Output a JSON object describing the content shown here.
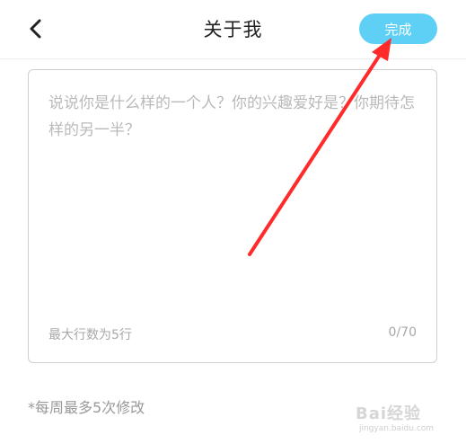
{
  "header": {
    "title": "关于我",
    "done_label": "完成",
    "done_color": "#5fd0f5"
  },
  "bio": {
    "placeholder": "说说你是什么样的一个人？你的兴趣爱好是？你期待怎样的另一半？",
    "value": "",
    "max_lines_hint": "最大行数为5行",
    "char_count": "0/70"
  },
  "edit_limit_note": "*每周最多5次修改",
  "annotation": {
    "arrow_color": "#ff2a2a"
  },
  "watermark": {
    "brand": "Bai经验",
    "url": "jingyan.baidu.com",
    "icons": [
      "paw-icon"
    ]
  }
}
